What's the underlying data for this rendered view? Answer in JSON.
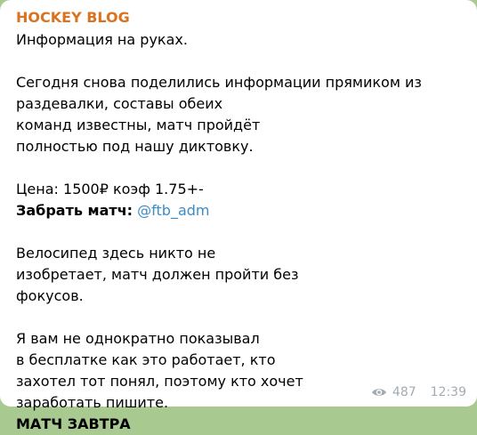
{
  "message": {
    "channel_name": "HOCKEY BLOG",
    "lines": {
      "l1": "Информация на руках.",
      "l2": "Сегодня снова поделились информации прямиком из",
      "l3": "раздевалки, составы обеих",
      "l4": "команд известны, матч пройдёт",
      "l5": "полностью под нашу диктовку.",
      "l6": "Цена: 1500₽ коэф 1.75+-",
      "l7_label": "Забрать матч:",
      "l7_link": "@ftb_adm",
      "l8": "Велосипед здесь никто не",
      "l9": "изобретает, матч должен пройти без",
      "l10": "фокусов.",
      "l11": "Я вам не однократно показывал",
      "l12": "в бесплатке как это работает, кто",
      "l13": "захотел тот понял, поэтому кто хочет",
      "l14": "заработать пишите.",
      "l15": "МАТЧ ЗАВТРА"
    },
    "views": "487",
    "time": "12:39"
  },
  "icons": {
    "views": "eye-icon"
  },
  "colors": {
    "channel_name": "#d9731f",
    "link": "#3a8cc7",
    "meta": "#a2acb4",
    "background": "#a8c98f"
  }
}
